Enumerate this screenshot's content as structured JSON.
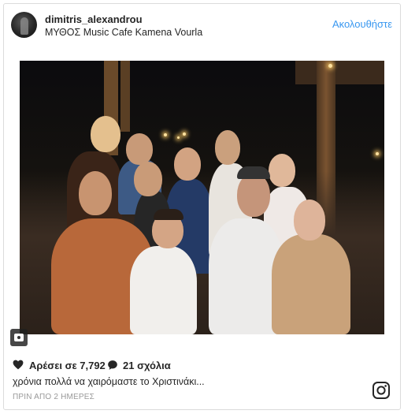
{
  "post": {
    "username": "dimitris_alexandrou",
    "location": "ΜΥΘΟΣ Music Cafe Kamena Vourla",
    "follow_label": "Ακολουθήστε",
    "likes_text": "Αρέσει σε 7,792",
    "comments_text": "21 σχόλια",
    "caption": "χρόνια πολλά να χαιρόμαστε το Χριστινάκι...",
    "timestamp": "ΠΡΙΝ ΑΠΟ 2 ΗΜΕΡΕΣ"
  },
  "icons": {
    "avatar": "avatar",
    "camera": "camera-icon",
    "heart": "heart-icon",
    "comment": "comment-bubble-icon",
    "instagram": "instagram-logo-icon"
  },
  "colors": {
    "accent": "#3897f0",
    "text": "#262626",
    "muted": "#999999",
    "border": "#dbdbdb"
  }
}
